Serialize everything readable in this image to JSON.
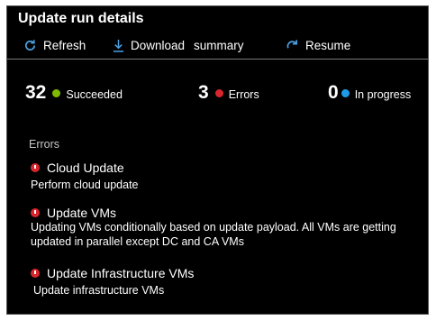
{
  "panel": {
    "title": "Update run details"
  },
  "toolbar": {
    "refresh_label": "Refresh",
    "download_label_1": "Download",
    "download_label_2": "summary",
    "resume_label": "Resume"
  },
  "stats": {
    "succeeded": {
      "count": "32",
      "label": "Succeeded",
      "color": "#7fba00",
      "icon": "check-circle-icon"
    },
    "errors": {
      "count": "3",
      "label": "Errors",
      "color": "#d9262c",
      "icon": "x-circle-icon"
    },
    "in_progress": {
      "count": "0",
      "label": "In progress",
      "color": "#1e9be8",
      "icon": "progress-dot-icon"
    }
  },
  "errors": {
    "heading": "Errors",
    "items": [
      {
        "title": "Cloud Update",
        "description": "Perform cloud update"
      },
      {
        "title": "Update VMs",
        "description": "Updating VMs conditionally based on update payload. All VMs are getting updated in parallel except DC and CA VMs"
      },
      {
        "title": "Update Infrastructure VMs",
        "description": "Update infrastructure VMs"
      }
    ]
  },
  "colors": {
    "background": "#000000",
    "error": "#d9262c",
    "accent": "#1e9be8",
    "success": "#7fba00"
  }
}
